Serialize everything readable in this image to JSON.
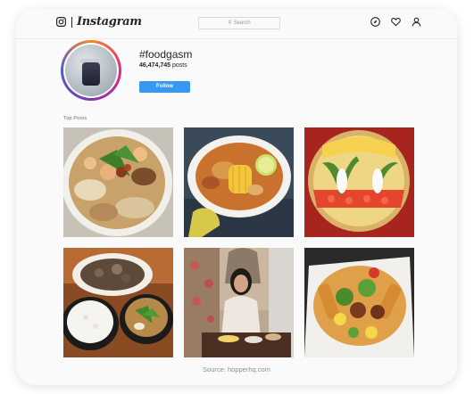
{
  "header": {
    "logo_text": "Instagram",
    "search_placeholder": "Search",
    "icons": [
      "camera-icon",
      "compass-icon",
      "heart-icon",
      "person-icon"
    ]
  },
  "profile": {
    "hashtag": "#foodgasm",
    "posts_count": "46,474,745",
    "posts_label": "posts",
    "follow_label": "Follow"
  },
  "top_posts": {
    "label": "Top Posts",
    "items": [
      "noodle-soup-post",
      "corn-soup-post",
      "pizza-art-post",
      "rice-meal-post",
      "woman-dining-post",
      "loaded-fries-post"
    ]
  },
  "caption": "Source: hopperhq.com"
}
